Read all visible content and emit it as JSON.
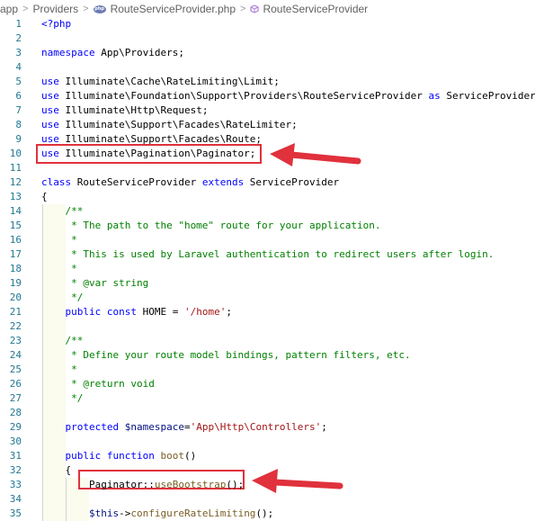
{
  "breadcrumb": {
    "items": [
      "app",
      "Providers",
      "RouteServiceProvider.php",
      "RouteServiceProvider"
    ],
    "php_badge": "php"
  },
  "lines": [
    {
      "n": "1",
      "parts": [
        {
          "t": "<?php",
          "c": "kw"
        }
      ]
    },
    {
      "n": "2",
      "parts": []
    },
    {
      "n": "3",
      "parts": [
        {
          "t": "namespace",
          "c": "kw"
        },
        {
          "t": " App\\Providers;",
          "c": ""
        }
      ]
    },
    {
      "n": "4",
      "parts": []
    },
    {
      "n": "5",
      "parts": [
        {
          "t": "use",
          "c": "kw"
        },
        {
          "t": " Illuminate\\Cache\\RateLimiting\\Limit;",
          "c": ""
        }
      ]
    },
    {
      "n": "6",
      "parts": [
        {
          "t": "use",
          "c": "kw"
        },
        {
          "t": " Illuminate\\Foundation\\Support\\Providers\\RouteServiceProvider ",
          "c": ""
        },
        {
          "t": "as",
          "c": "kw"
        },
        {
          "t": " ServiceProvider;",
          "c": ""
        }
      ]
    },
    {
      "n": "7",
      "parts": [
        {
          "t": "use",
          "c": "kw"
        },
        {
          "t": " Illuminate\\Http\\Request;",
          "c": ""
        }
      ]
    },
    {
      "n": "8",
      "parts": [
        {
          "t": "use",
          "c": "kw"
        },
        {
          "t": " Illuminate\\Support\\Facades\\RateLimiter;",
          "c": ""
        }
      ]
    },
    {
      "n": "9",
      "parts": [
        {
          "t": "use",
          "c": "kw"
        },
        {
          "t": " Illuminate\\Support\\Facades\\Route;",
          "c": ""
        }
      ]
    },
    {
      "n": "10",
      "parts": [
        {
          "t": "use",
          "c": "kw"
        },
        {
          "t": " Illuminate\\Pagination\\Paginator;",
          "c": ""
        }
      ]
    },
    {
      "n": "11",
      "parts": []
    },
    {
      "n": "12",
      "parts": [
        {
          "t": "class",
          "c": "kw"
        },
        {
          "t": " RouteServiceProvider ",
          "c": ""
        },
        {
          "t": "extends",
          "c": "kw"
        },
        {
          "t": " ServiceProvider",
          "c": ""
        }
      ]
    },
    {
      "n": "13",
      "parts": [
        {
          "t": "{",
          "c": ""
        }
      ]
    },
    {
      "n": "14",
      "parts": [
        {
          "t": "    /**",
          "c": "cm"
        }
      ]
    },
    {
      "n": "15",
      "parts": [
        {
          "t": "     * The path to the \"home\" route for your application.",
          "c": "cm"
        }
      ]
    },
    {
      "n": "16",
      "parts": [
        {
          "t": "     *",
          "c": "cm"
        }
      ]
    },
    {
      "n": "17",
      "parts": [
        {
          "t": "     * This is used by Laravel authentication to redirect users after login.",
          "c": "cm"
        }
      ]
    },
    {
      "n": "18",
      "parts": [
        {
          "t": "     *",
          "c": "cm"
        }
      ]
    },
    {
      "n": "19",
      "parts": [
        {
          "t": "     * @var string",
          "c": "cm"
        }
      ]
    },
    {
      "n": "20",
      "parts": [
        {
          "t": "     */",
          "c": "cm"
        }
      ]
    },
    {
      "n": "21",
      "parts": [
        {
          "t": "    ",
          "c": ""
        },
        {
          "t": "public",
          "c": "kw"
        },
        {
          "t": " ",
          "c": ""
        },
        {
          "t": "const",
          "c": "kw"
        },
        {
          "t": " HOME = ",
          "c": ""
        },
        {
          "t": "'/home'",
          "c": "str"
        },
        {
          "t": ";",
          "c": ""
        }
      ]
    },
    {
      "n": "22",
      "parts": []
    },
    {
      "n": "23",
      "parts": [
        {
          "t": "    /**",
          "c": "cm"
        }
      ]
    },
    {
      "n": "24",
      "parts": [
        {
          "t": "     * Define your route model bindings, pattern filters, etc.",
          "c": "cm"
        }
      ]
    },
    {
      "n": "25",
      "parts": [
        {
          "t": "     *",
          "c": "cm"
        }
      ]
    },
    {
      "n": "26",
      "parts": [
        {
          "t": "     * @return void",
          "c": "cm"
        }
      ]
    },
    {
      "n": "27",
      "parts": [
        {
          "t": "     */",
          "c": "cm"
        }
      ]
    },
    {
      "n": "28",
      "parts": []
    },
    {
      "n": "29",
      "parts": [
        {
          "t": "    ",
          "c": ""
        },
        {
          "t": "protected",
          "c": "kw"
        },
        {
          "t": " ",
          "c": ""
        },
        {
          "t": "$namespace",
          "c": "var"
        },
        {
          "t": "=",
          "c": ""
        },
        {
          "t": "'App\\Http\\Controllers'",
          "c": "str"
        },
        {
          "t": ";",
          "c": ""
        }
      ]
    },
    {
      "n": "30",
      "parts": []
    },
    {
      "n": "31",
      "parts": [
        {
          "t": "    ",
          "c": ""
        },
        {
          "t": "public",
          "c": "kw"
        },
        {
          "t": " ",
          "c": ""
        },
        {
          "t": "function",
          "c": "kw"
        },
        {
          "t": " ",
          "c": ""
        },
        {
          "t": "boot",
          "c": "fn"
        },
        {
          "t": "()",
          "c": ""
        }
      ]
    },
    {
      "n": "32",
      "parts": [
        {
          "t": "    {",
          "c": ""
        }
      ]
    },
    {
      "n": "33",
      "parts": [
        {
          "t": "        Paginator::",
          "c": ""
        },
        {
          "t": "useBootstrap",
          "c": "fn"
        },
        {
          "t": "();",
          "c": ""
        }
      ]
    },
    {
      "n": "34",
      "parts": []
    },
    {
      "n": "35",
      "parts": [
        {
          "t": "        ",
          "c": ""
        },
        {
          "t": "$this",
          "c": "var"
        },
        {
          "t": "->",
          "c": ""
        },
        {
          "t": "configureRateLimiting",
          "c": "fn"
        },
        {
          "t": "();",
          "c": ""
        }
      ]
    }
  ]
}
